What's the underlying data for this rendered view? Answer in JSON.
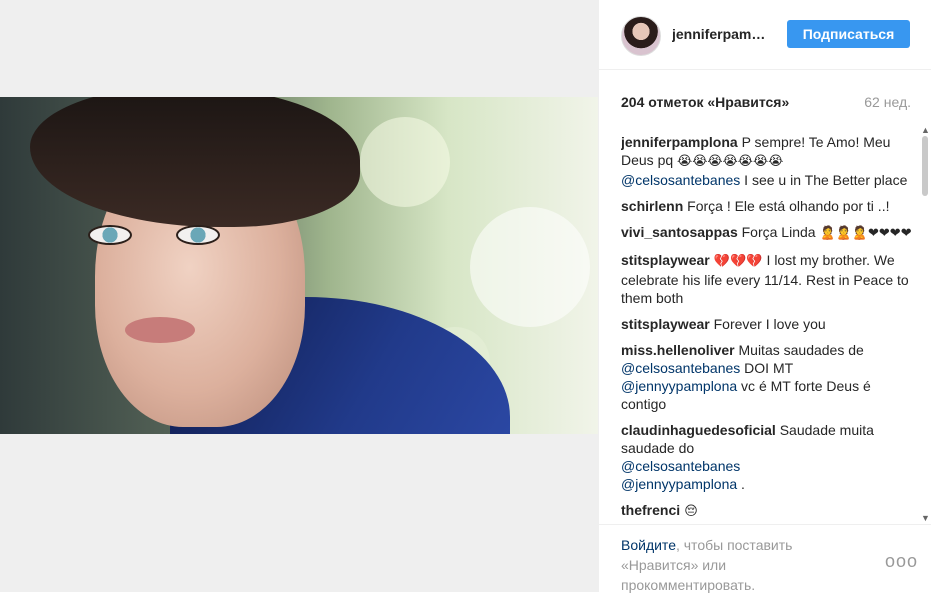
{
  "post": {
    "username": "jenniferpam…",
    "follow_label": "Подписаться",
    "likes": "204 отметок «Нравится»",
    "age": "62 нед."
  },
  "comments": [
    {
      "author": "jenniferpamplona",
      "text1": " P sempre! Te Amo! Meu Deus pq ",
      "emoji": "😭😭😭😭😭😭😭",
      "mention": "@celsosantebanes",
      "text2": " I see u in The Better place"
    },
    {
      "author": "schirlenn",
      "text": " Força ! Ele está olhando por ti ..!"
    },
    {
      "author": "vivi_santosappas",
      "text": " Força Linda ",
      "emoji": "🙎🙎🙎❤❤❤❤"
    },
    {
      "author": "stitsplaywear",
      "emoji": " 💔💔💔 ",
      "text": "I lost my brother. We celebrate his life every 11/14. Rest in Peace to them both"
    },
    {
      "author": "stitsplaywear",
      "text": " Forever I love you"
    },
    {
      "author": "miss.hellenoliver",
      "text1": " Muitas saudades de ",
      "mention1": "@celsosantebanes",
      "text2": " DOI MT ",
      "mention2": "@jennyypamplona",
      "text3": " vc é MT forte Deus é contigo"
    },
    {
      "author": "claudinhaguedesoficial",
      "text1": " Saudade muita saudade do ",
      "mention1": "@celsosantebanes",
      "text2": " ",
      "mention2": "@jennyypamplona",
      "text3": " ."
    },
    {
      "author": "thefrenci",
      "emoji": " 😔"
    }
  ],
  "footer": {
    "login_link": "Войдите",
    "login_text": ", чтобы поставить «Нравится» или прокомментировать.",
    "more": "ooo"
  }
}
